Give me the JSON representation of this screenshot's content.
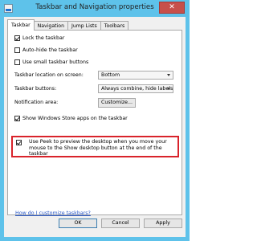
{
  "window": {
    "title": "Taskbar and Navigation properties",
    "close_glyph": "✕"
  },
  "tabs": [
    {
      "label": "Taskbar",
      "active": true
    },
    {
      "label": "Navigation"
    },
    {
      "label": "Jump Lists"
    },
    {
      "label": "Toolbars"
    }
  ],
  "taskbar_tab": {
    "lock_taskbar": {
      "label": "Lock the taskbar",
      "checked": true
    },
    "auto_hide": {
      "label": "Auto-hide the taskbar",
      "checked": false
    },
    "small_buttons": {
      "label": "Use small taskbar buttons",
      "checked": false
    },
    "location": {
      "label": "Taskbar location on screen:",
      "value": "Bottom"
    },
    "buttons": {
      "label": "Taskbar buttons:",
      "value": "Always combine, hide labels"
    },
    "notification": {
      "label": "Notification area:",
      "button_label": "Customize..."
    },
    "store_apps": {
      "label": "Show Windows Store apps on the taskbar",
      "checked": true
    },
    "peek": {
      "label": "Use Peek to preview the desktop when you move your mouse to the Show desktop button at the end of the taskbar",
      "checked": true
    },
    "help_link": "How do I customize taskbars?"
  },
  "footer": {
    "ok": "OK",
    "cancel": "Cancel",
    "apply": "Apply"
  },
  "colors": {
    "frame": "#5ec2ea",
    "close": "#c7504b",
    "highlight": "#d9232b",
    "link": "#2a59c6"
  }
}
